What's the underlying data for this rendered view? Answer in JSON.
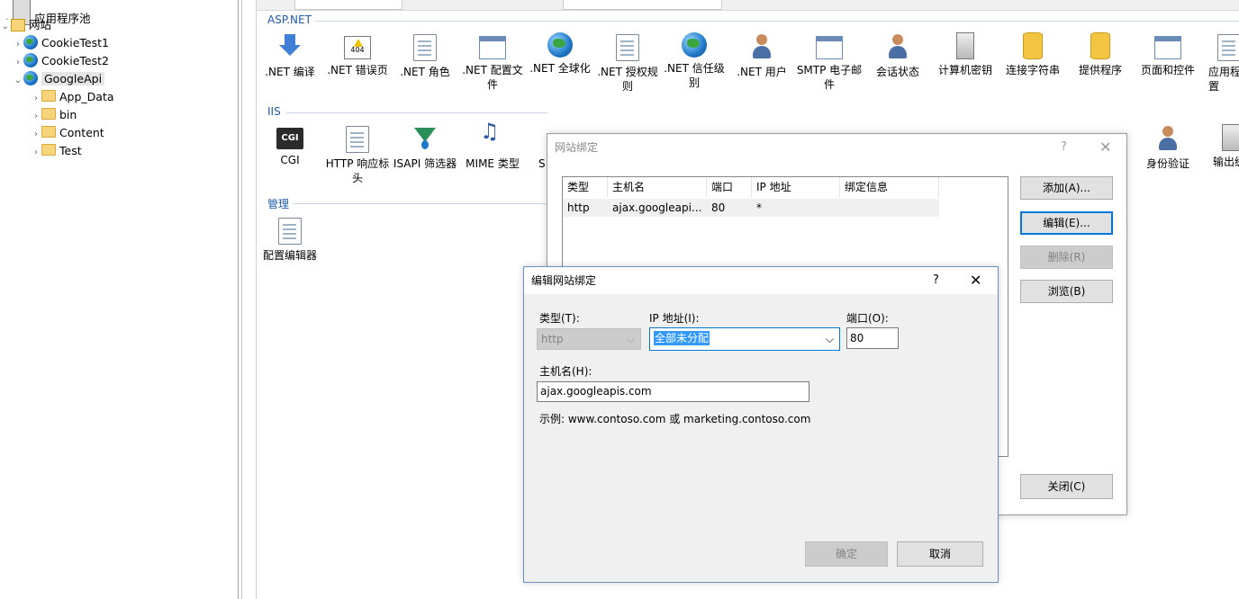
{
  "tree": {
    "app_pools": "应用程序池",
    "sites": "网站",
    "site_items": [
      "CookieTest1",
      "CookieTest2",
      "GoogleApi"
    ],
    "folders": [
      "App_Data",
      "bin",
      "Content",
      "Test"
    ]
  },
  "sections": {
    "aspnet_title": "ASP.NET",
    "iis_title": "IIS",
    "manage_title": "管理"
  },
  "aspnet_features": [
    ".NET 编译",
    ".NET 错误页",
    ".NET 角色",
    ".NET 配置文件",
    ".NET 全球化",
    ".NET 授权规则",
    ".NET 信任级别",
    ".NET 用户",
    "SMTP 电子邮件",
    "会话状态",
    "计算机密钥",
    "连接字符串",
    "提供程序",
    "页面和控件",
    "应用程序设置"
  ],
  "iis_features": {
    "cgi": "CGI",
    "http_headers": "HTTP 响应标头",
    "isapi": "ISAPI 筛选器",
    "mime": "MIME 类型",
    "ssl_partial": "SS",
    "auth": "身份验证",
    "output_partial": "输出缓"
  },
  "manage_features": [
    "配置编辑器"
  ],
  "bindings_dialog": {
    "title": "网站绑定",
    "help": "?",
    "close_glyph": "✕",
    "columns": [
      "类型",
      "主机名",
      "端口",
      "IP 地址",
      "绑定信息"
    ],
    "rows": [
      {
        "type": "http",
        "host": "ajax.googleapi...",
        "port": "80",
        "ip": "*",
        "info": ""
      }
    ],
    "buttons": {
      "add": "添加(A)...",
      "edit": "编辑(E)...",
      "remove": "删除(R)",
      "browse": "浏览(B)",
      "close": "关闭(C)"
    }
  },
  "edit_dialog": {
    "title": "编辑网站绑定",
    "help": "?",
    "close_glyph": "✕",
    "type_label": "类型(T):",
    "type_value": "http",
    "ip_label": "IP 地址(I):",
    "ip_value": "全部未分配",
    "port_label": "端口(O):",
    "port_value": "80",
    "host_label": "主机名(H):",
    "host_value": "ajax.googleapis.com",
    "example": "示例: www.contoso.com 或 marketing.contoso.com",
    "ok": "确定",
    "cancel": "取消"
  },
  "colors": {
    "accent": "#0078d7",
    "section_title": "#1e5aa8",
    "selection_bg": "#3399ff"
  }
}
